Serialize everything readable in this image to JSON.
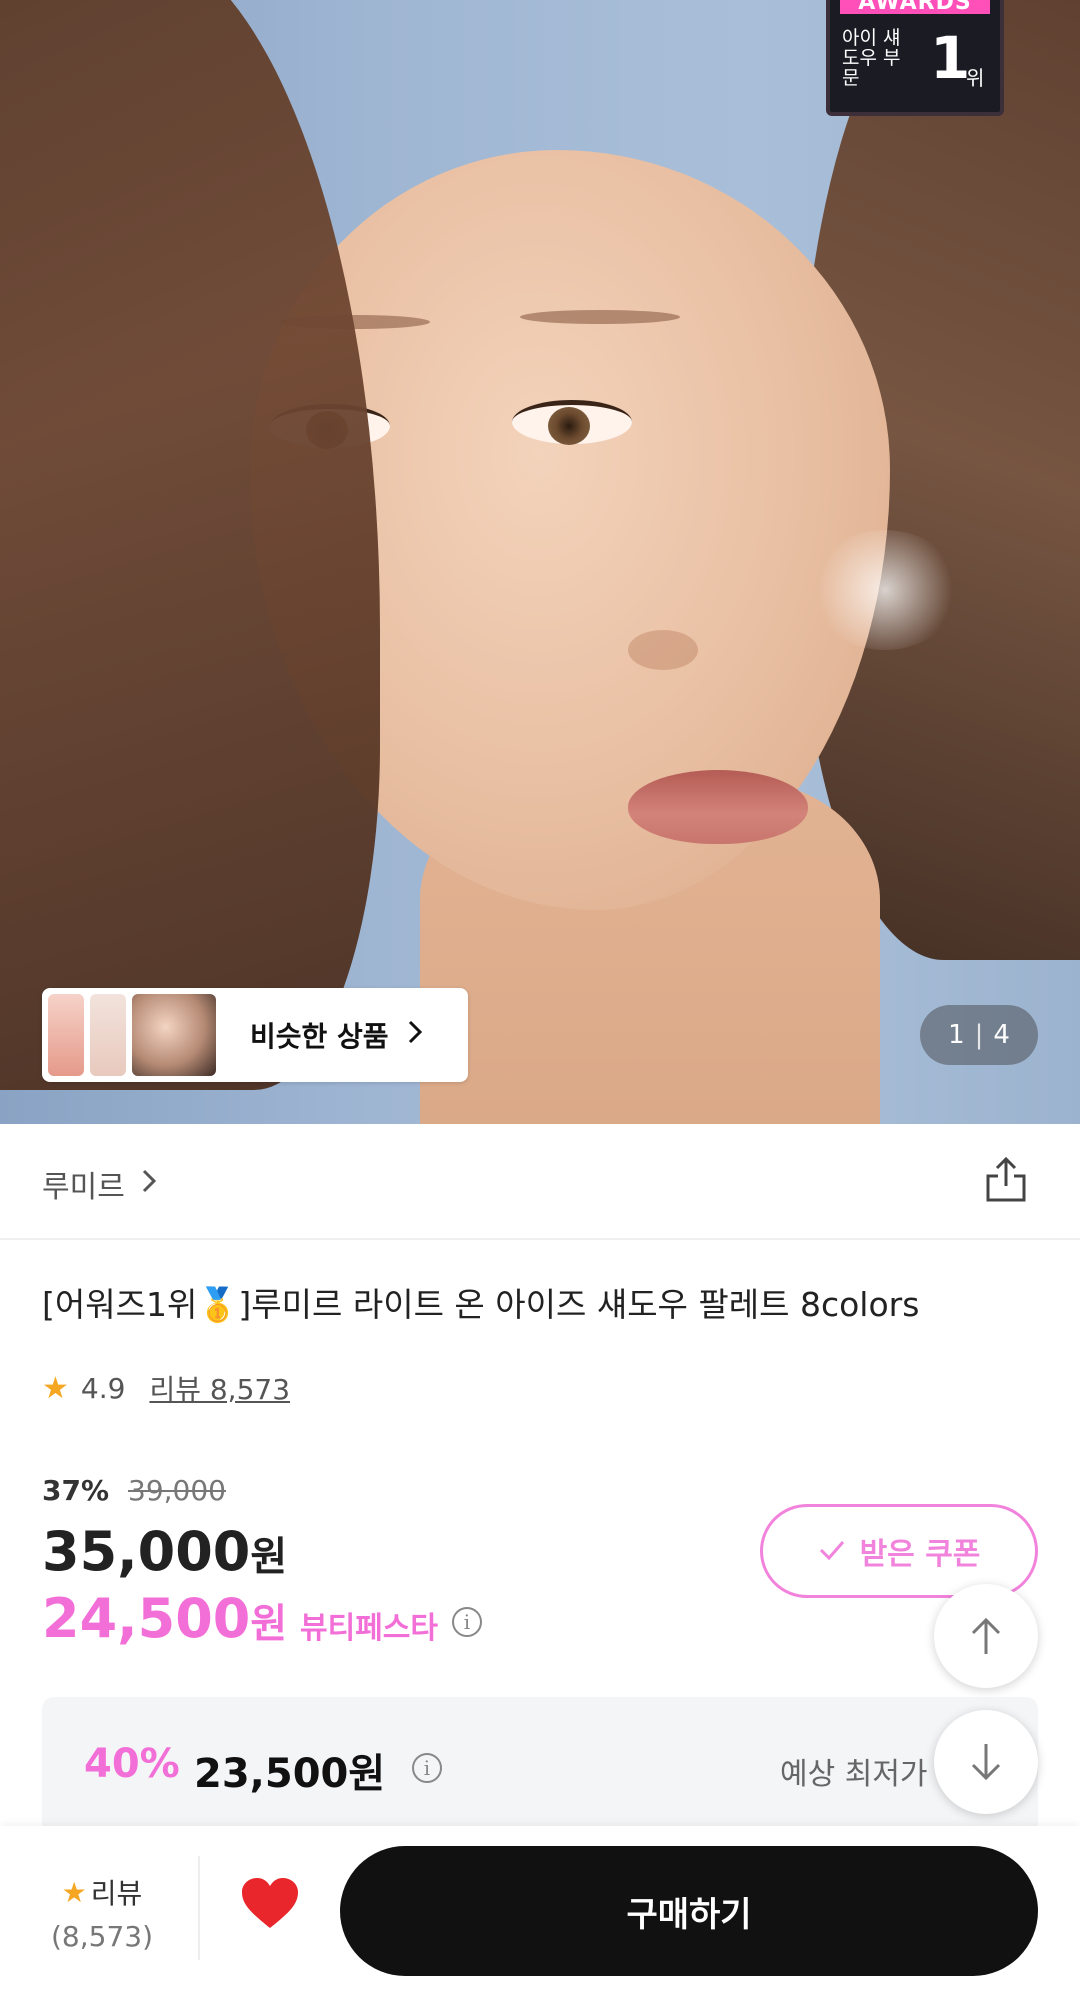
{
  "hero": {
    "award": {
      "title": "AWARDS",
      "category": "아이 섀도우 부문",
      "rank": "1",
      "rank_unit": "위"
    },
    "similar_label": "비슷한 상품",
    "page_current": "1",
    "page_separator": "|",
    "page_total": "4"
  },
  "brand": {
    "name": "루미르"
  },
  "product": {
    "title": "[어워즈1위🥇]루미르 라이트 온 아이즈 섀도우 팔레트 8colors",
    "rating": "4.9",
    "review_text": "리뷰 8,573"
  },
  "price": {
    "discount": "37%",
    "original": "39,000",
    "current": "35,000",
    "currency": "원",
    "festa_price": "24,500",
    "festa_label": "뷰티페스타",
    "coupon_label": "받은 쿠폰",
    "lowest_pct": "40%",
    "lowest_price": "23,500원",
    "lowest_label": "예상 최저가"
  },
  "bottom_bar": {
    "review_label": "리뷰",
    "review_count": "(8,573)",
    "buy_label": "구매하기"
  },
  "colors": {
    "accent_pink": "#f36fd8",
    "star": "#f5a623",
    "heart": "#e8262b",
    "buy_button": "#111111"
  }
}
